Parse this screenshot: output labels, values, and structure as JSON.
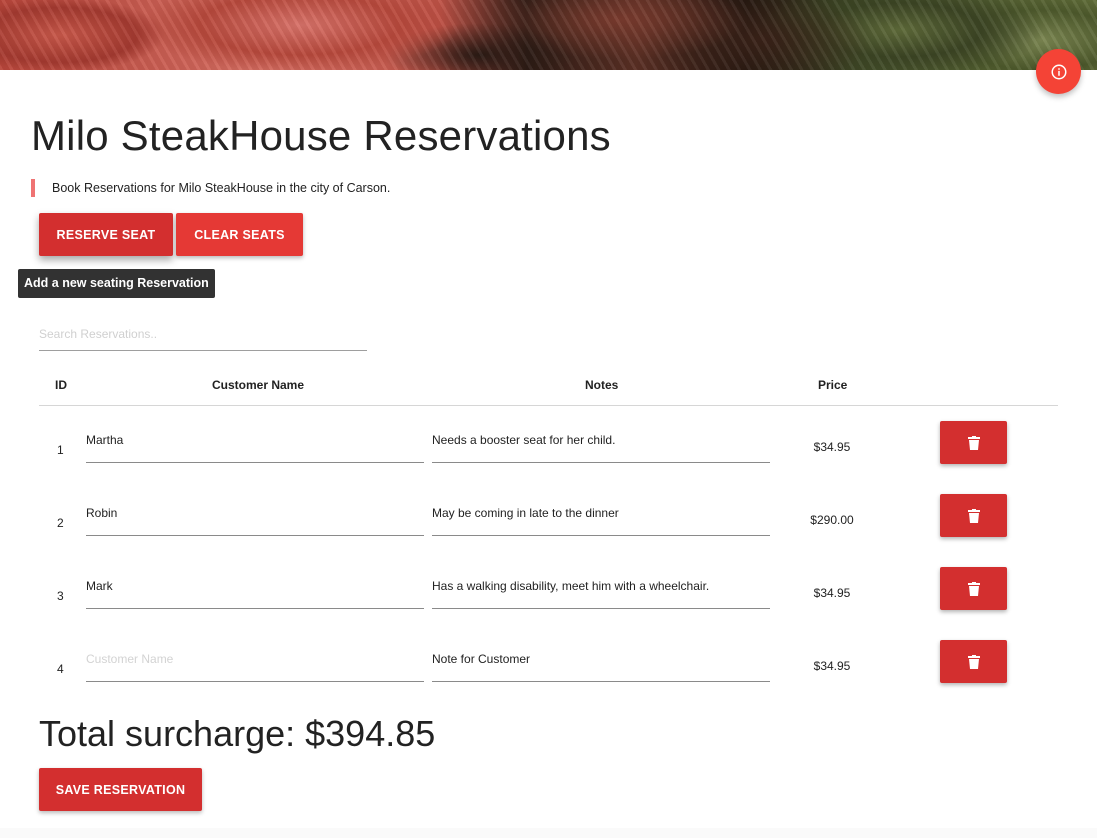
{
  "header": {
    "info_icon": "info-icon"
  },
  "page": {
    "title": "Milo SteakHouse Reservations",
    "subtitle": "Book Reservations for Milo SteakHouse in the city of Carson."
  },
  "toolbar": {
    "reserve_label": "RESERVE SEAT",
    "clear_label": "CLEAR SEATS",
    "tooltip": "Add a new seating Reservation"
  },
  "search": {
    "placeholder": "Search Reservations..",
    "value": ""
  },
  "table": {
    "headers": {
      "id": "ID",
      "name": "Customer Name",
      "notes": "Notes",
      "price": "Price"
    },
    "rows": [
      {
        "id": "1",
        "name": "Martha",
        "name_placeholder": "Customer Name",
        "notes": "Needs a booster seat for her child.",
        "notes_placeholder": "Note for Customer",
        "price": "$34.95",
        "delete_icon": "trash-icon"
      },
      {
        "id": "2",
        "name": "Robin",
        "name_placeholder": "Customer Name",
        "notes": "May be coming in late to the dinner",
        "notes_placeholder": "Note for Customer",
        "price": "$290.00",
        "delete_icon": "trash-icon"
      },
      {
        "id": "3",
        "name": "Mark",
        "name_placeholder": "Customer Name",
        "notes": "Has a walking disability, meet him with a wheelchair.",
        "notes_placeholder": "Note for Customer",
        "price": "$34.95",
        "delete_icon": "trash-icon"
      },
      {
        "id": "4",
        "name": "",
        "name_placeholder": "Customer Name",
        "notes": "Note for Customer",
        "notes_placeholder": "Note for Customer",
        "price": "$34.95",
        "delete_icon": "trash-icon"
      }
    ]
  },
  "summary": {
    "total_label": "Total surcharge: ",
    "total_value": "$394.85",
    "save_label": "SAVE RESERVATION"
  },
  "colors": {
    "primary": "#d32f2f",
    "accent": "#f44336",
    "quote_bar": "#ef7373"
  }
}
